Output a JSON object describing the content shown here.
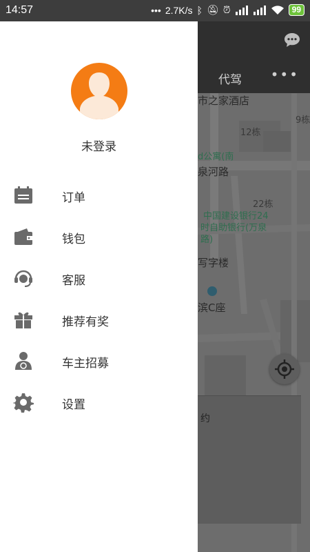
{
  "status_bar": {
    "time": "14:57",
    "dots": "•••",
    "speed": "2.7K/s",
    "battery": "99"
  },
  "background_app": {
    "tab_label": "代驾",
    "more": "•••",
    "map_labels": [
      "市之家酒店",
      "9栋",
      "12栋",
      "d公寓(南",
      "泉河路",
      "22栋",
      "中国建设银行24",
      "时自助银行(万泉",
      "路)",
      "写字楼",
      "滨C座",
      "约"
    ]
  },
  "drawer": {
    "username": "未登录",
    "menu": [
      {
        "label": "订单",
        "icon": "calendar-icon"
      },
      {
        "label": "钱包",
        "icon": "wallet-icon"
      },
      {
        "label": "客服",
        "icon": "headset-icon"
      },
      {
        "label": "推荐有奖",
        "icon": "gift-icon"
      },
      {
        "label": "车主招募",
        "icon": "driver-icon"
      },
      {
        "label": "设置",
        "icon": "gear-icon"
      }
    ]
  },
  "colors": {
    "avatar_bg": "#f47c14",
    "icon_gray": "#6a6a6a",
    "status_bg": "#3d3d3d"
  }
}
